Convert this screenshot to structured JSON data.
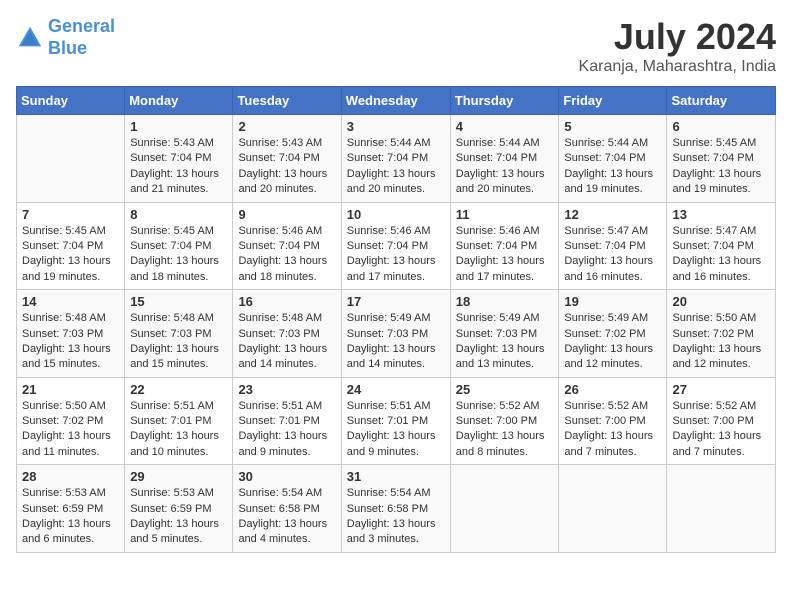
{
  "logo": {
    "line1": "General",
    "line2": "Blue"
  },
  "title": "July 2024",
  "location": "Karanja, Maharashtra, India",
  "headers": [
    "Sunday",
    "Monday",
    "Tuesday",
    "Wednesday",
    "Thursday",
    "Friday",
    "Saturday"
  ],
  "weeks": [
    [
      {
        "day": "",
        "info": ""
      },
      {
        "day": "1",
        "info": "Sunrise: 5:43 AM\nSunset: 7:04 PM\nDaylight: 13 hours\nand 21 minutes."
      },
      {
        "day": "2",
        "info": "Sunrise: 5:43 AM\nSunset: 7:04 PM\nDaylight: 13 hours\nand 20 minutes."
      },
      {
        "day": "3",
        "info": "Sunrise: 5:44 AM\nSunset: 7:04 PM\nDaylight: 13 hours\nand 20 minutes."
      },
      {
        "day": "4",
        "info": "Sunrise: 5:44 AM\nSunset: 7:04 PM\nDaylight: 13 hours\nand 20 minutes."
      },
      {
        "day": "5",
        "info": "Sunrise: 5:44 AM\nSunset: 7:04 PM\nDaylight: 13 hours\nand 19 minutes."
      },
      {
        "day": "6",
        "info": "Sunrise: 5:45 AM\nSunset: 7:04 PM\nDaylight: 13 hours\nand 19 minutes."
      }
    ],
    [
      {
        "day": "7",
        "info": "Sunrise: 5:45 AM\nSunset: 7:04 PM\nDaylight: 13 hours\nand 19 minutes."
      },
      {
        "day": "8",
        "info": "Sunrise: 5:45 AM\nSunset: 7:04 PM\nDaylight: 13 hours\nand 18 minutes."
      },
      {
        "day": "9",
        "info": "Sunrise: 5:46 AM\nSunset: 7:04 PM\nDaylight: 13 hours\nand 18 minutes."
      },
      {
        "day": "10",
        "info": "Sunrise: 5:46 AM\nSunset: 7:04 PM\nDaylight: 13 hours\nand 17 minutes."
      },
      {
        "day": "11",
        "info": "Sunrise: 5:46 AM\nSunset: 7:04 PM\nDaylight: 13 hours\nand 17 minutes."
      },
      {
        "day": "12",
        "info": "Sunrise: 5:47 AM\nSunset: 7:04 PM\nDaylight: 13 hours\nand 16 minutes."
      },
      {
        "day": "13",
        "info": "Sunrise: 5:47 AM\nSunset: 7:04 PM\nDaylight: 13 hours\nand 16 minutes."
      }
    ],
    [
      {
        "day": "14",
        "info": "Sunrise: 5:48 AM\nSunset: 7:03 PM\nDaylight: 13 hours\nand 15 minutes."
      },
      {
        "day": "15",
        "info": "Sunrise: 5:48 AM\nSunset: 7:03 PM\nDaylight: 13 hours\nand 15 minutes."
      },
      {
        "day": "16",
        "info": "Sunrise: 5:48 AM\nSunset: 7:03 PM\nDaylight: 13 hours\nand 14 minutes."
      },
      {
        "day": "17",
        "info": "Sunrise: 5:49 AM\nSunset: 7:03 PM\nDaylight: 13 hours\nand 14 minutes."
      },
      {
        "day": "18",
        "info": "Sunrise: 5:49 AM\nSunset: 7:03 PM\nDaylight: 13 hours\nand 13 minutes."
      },
      {
        "day": "19",
        "info": "Sunrise: 5:49 AM\nSunset: 7:02 PM\nDaylight: 13 hours\nand 12 minutes."
      },
      {
        "day": "20",
        "info": "Sunrise: 5:50 AM\nSunset: 7:02 PM\nDaylight: 13 hours\nand 12 minutes."
      }
    ],
    [
      {
        "day": "21",
        "info": "Sunrise: 5:50 AM\nSunset: 7:02 PM\nDaylight: 13 hours\nand 11 minutes."
      },
      {
        "day": "22",
        "info": "Sunrise: 5:51 AM\nSunset: 7:01 PM\nDaylight: 13 hours\nand 10 minutes."
      },
      {
        "day": "23",
        "info": "Sunrise: 5:51 AM\nSunset: 7:01 PM\nDaylight: 13 hours\nand 9 minutes."
      },
      {
        "day": "24",
        "info": "Sunrise: 5:51 AM\nSunset: 7:01 PM\nDaylight: 13 hours\nand 9 minutes."
      },
      {
        "day": "25",
        "info": "Sunrise: 5:52 AM\nSunset: 7:00 PM\nDaylight: 13 hours\nand 8 minutes."
      },
      {
        "day": "26",
        "info": "Sunrise: 5:52 AM\nSunset: 7:00 PM\nDaylight: 13 hours\nand 7 minutes."
      },
      {
        "day": "27",
        "info": "Sunrise: 5:52 AM\nSunset: 7:00 PM\nDaylight: 13 hours\nand 7 minutes."
      }
    ],
    [
      {
        "day": "28",
        "info": "Sunrise: 5:53 AM\nSunset: 6:59 PM\nDaylight: 13 hours\nand 6 minutes."
      },
      {
        "day": "29",
        "info": "Sunrise: 5:53 AM\nSunset: 6:59 PM\nDaylight: 13 hours\nand 5 minutes."
      },
      {
        "day": "30",
        "info": "Sunrise: 5:54 AM\nSunset: 6:58 PM\nDaylight: 13 hours\nand 4 minutes."
      },
      {
        "day": "31",
        "info": "Sunrise: 5:54 AM\nSunset: 6:58 PM\nDaylight: 13 hours\nand 3 minutes."
      },
      {
        "day": "",
        "info": ""
      },
      {
        "day": "",
        "info": ""
      },
      {
        "day": "",
        "info": ""
      }
    ]
  ]
}
